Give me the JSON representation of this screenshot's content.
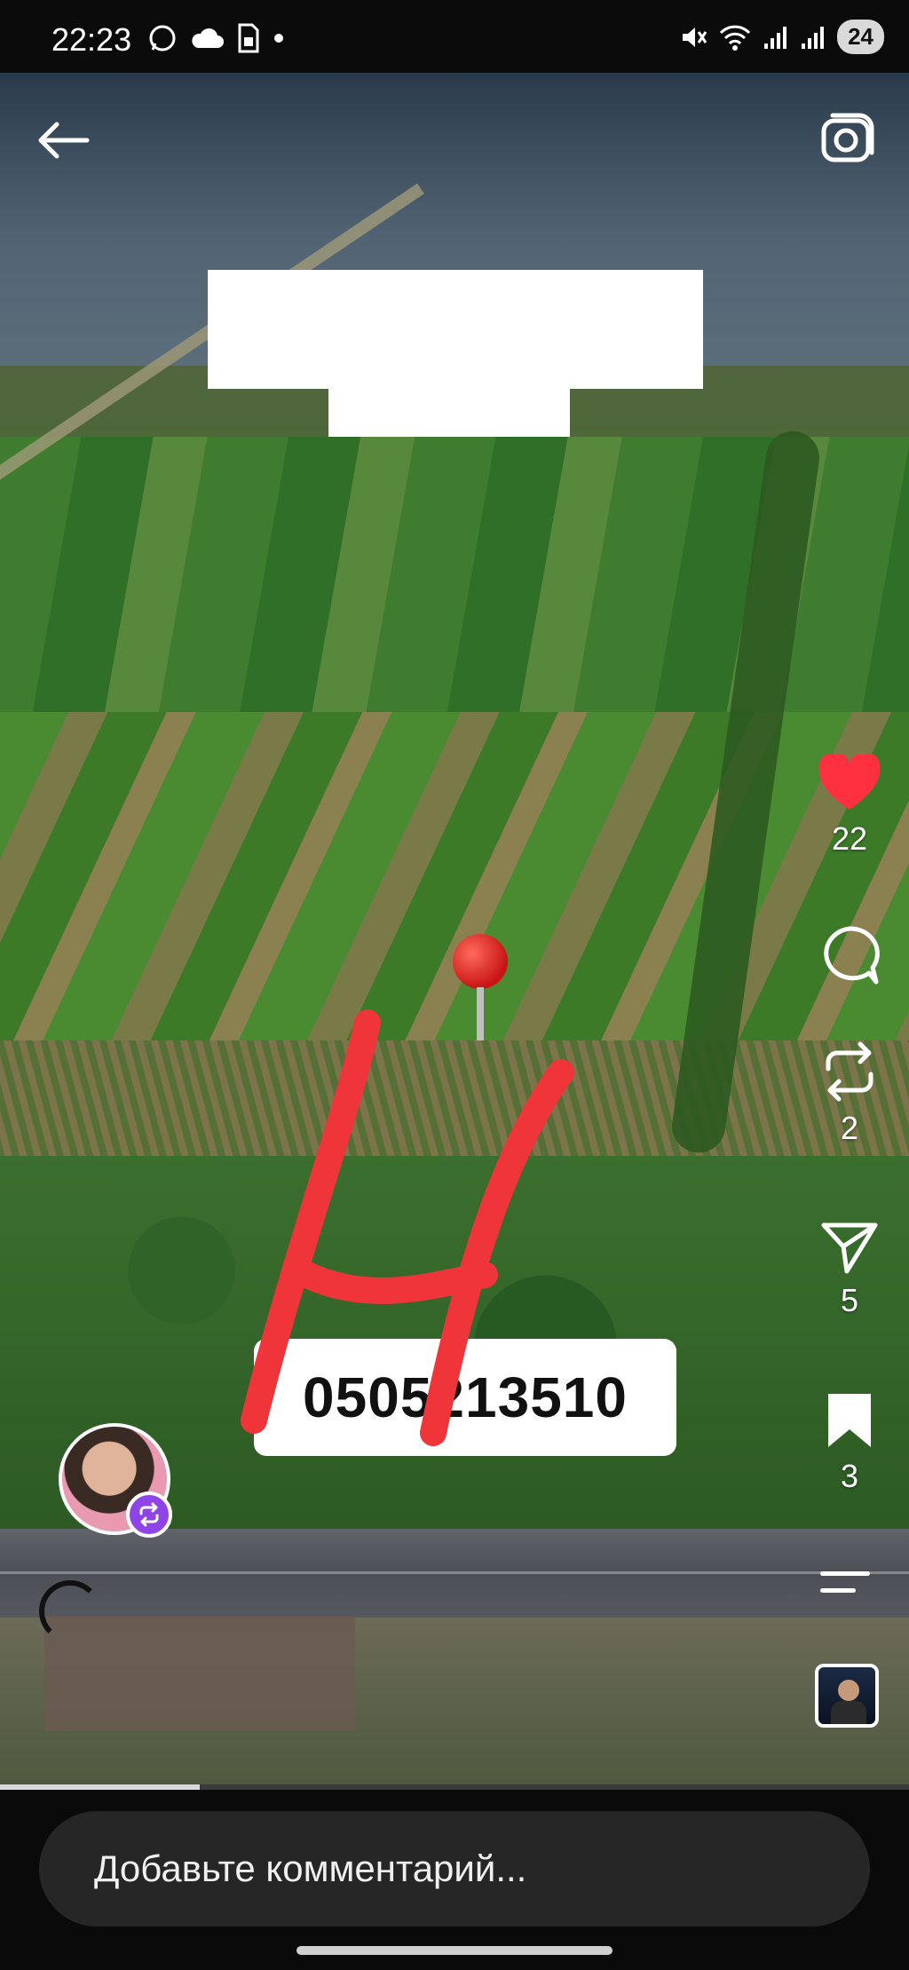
{
  "status_bar": {
    "time": "22:23",
    "battery": "24",
    "left_icons": [
      "whatsapp-icon",
      "cloud-icon",
      "sim-icon",
      "dot-icon"
    ],
    "right_icons": [
      "mute-icon",
      "wifi-icon",
      "signal-icon",
      "signal-icon"
    ]
  },
  "video": {
    "overlay_phone": "0505213510"
  },
  "top_bar": {
    "back_icon": "arrow-left-icon",
    "camera_icon": "camera-icon"
  },
  "actions": {
    "likes": "22",
    "comments": "",
    "reposts": "2",
    "shares": "5",
    "saves": "3",
    "like_color": "#ff3040"
  },
  "playback": {
    "progress_percent": 22
  },
  "comment": {
    "placeholder": "Добавьте комментарий..."
  }
}
